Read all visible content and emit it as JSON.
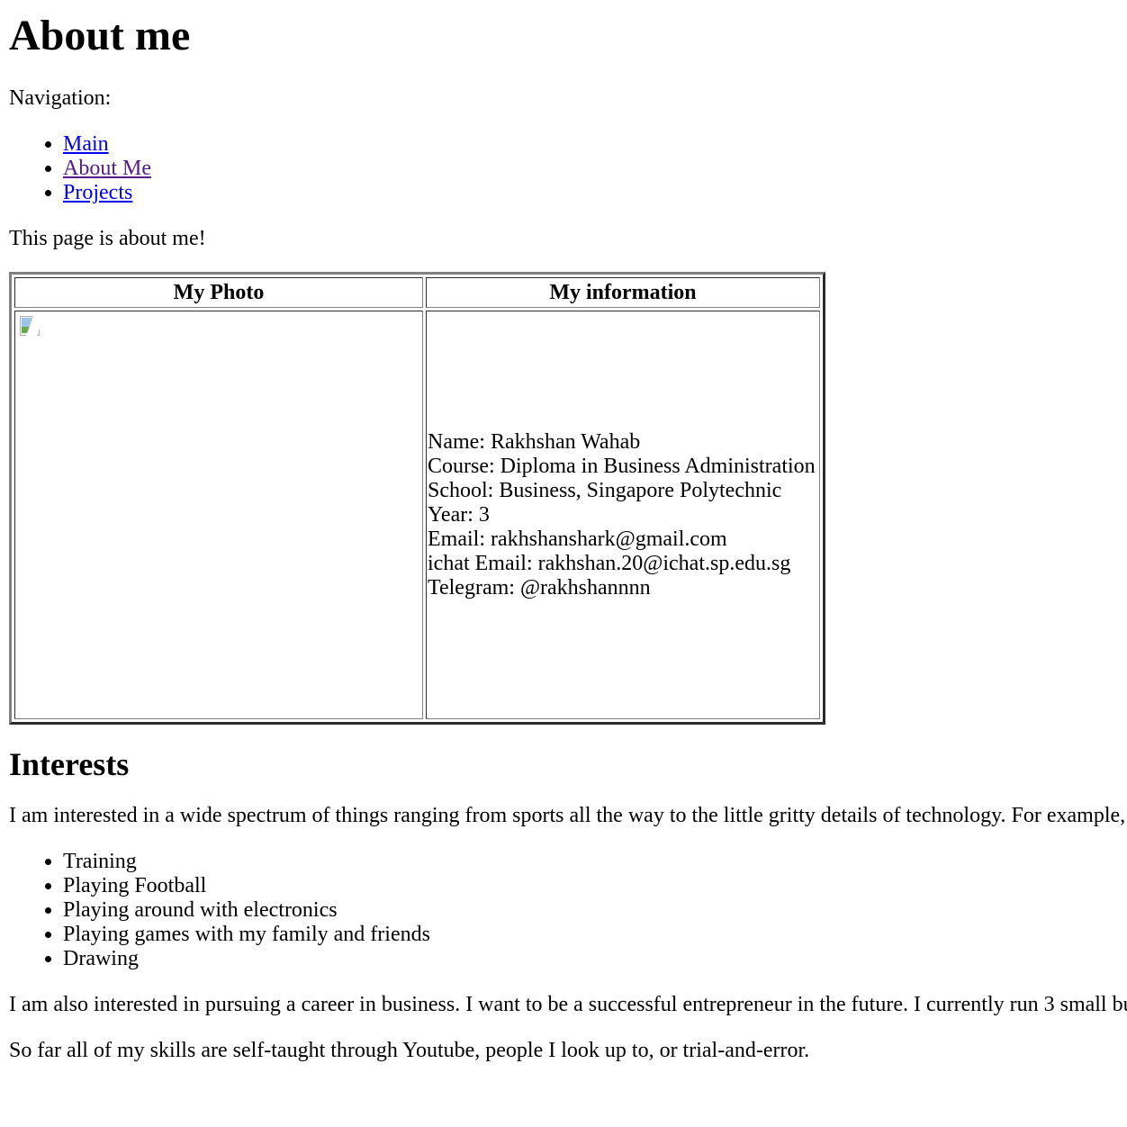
{
  "page": {
    "heading": "About me",
    "nav_label": "Navigation:",
    "nav_links": [
      {
        "label": "Main",
        "state": "unvisited"
      },
      {
        "label": "About Me",
        "state": "visited"
      },
      {
        "label": "Projects",
        "state": "unvisited"
      }
    ],
    "intro": "This page is about me!"
  },
  "table": {
    "headers": {
      "photo": "My Photo",
      "information": "My information"
    },
    "photo": {
      "state": "broken-image-icon"
    },
    "info_lines": [
      "Name: Rakhshan Wahab",
      "Course: Diploma in Business Administration",
      "School: Business, Singapore Polytechnic",
      "Year: 3",
      "Email: rakhshanshark@gmail.com",
      "ichat Email: rakhshan.20@ichat.sp.edu.sg",
      "Telegram: @rakhshannnn"
    ]
  },
  "interests": {
    "heading": "Interests",
    "text": "I am interested in a wide spectrum of things ranging from sports all the way to the little gritty details of technology. For example,",
    "items": [
      "Training",
      "Playing Football",
      "Playing around with electronics",
      "Playing games with my family and friends",
      "Drawing"
    ],
    "career_text": "I am also interested in pursuing a career in business. I want to be a successful entrepreneur in the future. I currently run 3 small bu",
    "skills_text": "So far all of my skills are self-taught through Youtube, people I look up to, or trial-and-error."
  },
  "colors": {
    "link": "#0000ee",
    "visited_link": "#551a8b",
    "text": "#000000",
    "background": "#ffffff"
  }
}
